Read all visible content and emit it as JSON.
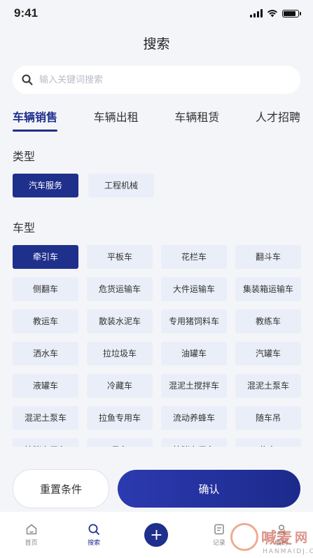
{
  "status": {
    "time": "9:41"
  },
  "header": {
    "title": "搜索"
  },
  "search": {
    "placeholder": "输入关键词搜索"
  },
  "tabs": [
    {
      "label": "车辆销售",
      "active": true
    },
    {
      "label": "车辆出租",
      "active": false
    },
    {
      "label": "车辆租赁",
      "active": false
    },
    {
      "label": "人才招聘",
      "active": false
    }
  ],
  "type_section": {
    "label": "类型",
    "options": [
      {
        "label": "汽车服务",
        "active": true
      },
      {
        "label": "工程机械",
        "active": false
      }
    ]
  },
  "model_section": {
    "label": "车型",
    "options": [
      {
        "label": "牵引车",
        "active": true
      },
      {
        "label": "平板车",
        "active": false
      },
      {
        "label": "花栏车",
        "active": false
      },
      {
        "label": "翻斗车",
        "active": false
      },
      {
        "label": "侧翻车",
        "active": false
      },
      {
        "label": "危货运输车",
        "active": false
      },
      {
        "label": "大件运输车",
        "active": false
      },
      {
        "label": "集装箱运输车",
        "active": false
      },
      {
        "label": "教运车",
        "active": false
      },
      {
        "label": "散装水泥车",
        "active": false
      },
      {
        "label": "专用猪饲料车",
        "active": false
      },
      {
        "label": "教练车",
        "active": false
      },
      {
        "label": "洒水车",
        "active": false
      },
      {
        "label": "拉垃圾车",
        "active": false
      },
      {
        "label": "油罐车",
        "active": false
      },
      {
        "label": "汽罐车",
        "active": false
      },
      {
        "label": "液罐车",
        "active": false
      },
      {
        "label": "冷藏车",
        "active": false
      },
      {
        "label": "混泥土搅拌车",
        "active": false
      },
      {
        "label": "混泥土泵车",
        "active": false
      },
      {
        "label": "混泥土泵车",
        "active": false
      },
      {
        "label": "拉鱼专用车",
        "active": false
      },
      {
        "label": "流动养蜂车",
        "active": false
      },
      {
        "label": "随车吊",
        "active": false
      },
      {
        "label": "拉猪专用车",
        "active": false
      },
      {
        "label": "吊车",
        "active": false
      },
      {
        "label": "拉猪专用车",
        "active": false
      },
      {
        "label": "拖车",
        "active": false
      }
    ]
  },
  "actions": {
    "reset_label": "重置条件",
    "confirm_label": "确认"
  },
  "nav": [
    {
      "label": "首页",
      "icon": "home-icon",
      "active": false
    },
    {
      "label": "搜索",
      "icon": "search-icon",
      "active": true
    },
    {
      "label": "",
      "icon": "plus-icon",
      "active": false
    },
    {
      "label": "记录",
      "icon": "record-icon",
      "active": false
    },
    {
      "label": "我的",
      "icon": "profile-icon",
      "active": false
    }
  ],
  "watermark": {
    "text": "喊麦",
    "suffix": "网",
    "sub": "HANMAIDJ.COM"
  },
  "colors": {
    "accent": "#1f2f8c",
    "chip_bg": "#eaeef8",
    "page_bg": "#f4f5f8"
  }
}
